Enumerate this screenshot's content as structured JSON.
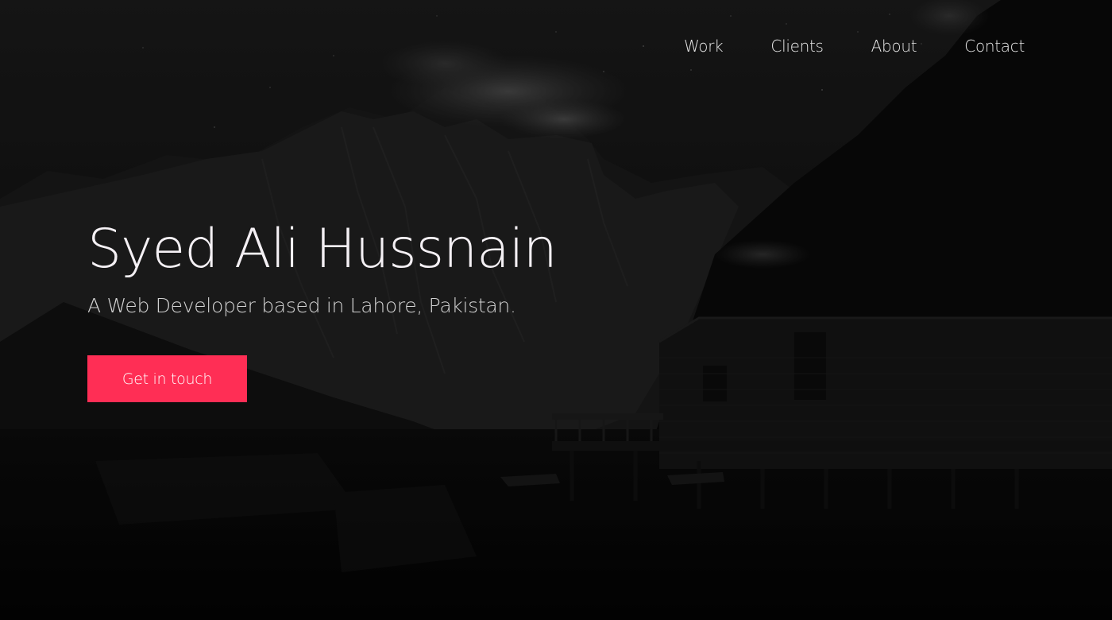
{
  "nav": {
    "items": [
      {
        "label": "Work"
      },
      {
        "label": "Clients"
      },
      {
        "label": "About"
      },
      {
        "label": "Contact"
      }
    ]
  },
  "hero": {
    "title": "Syed Ali Hussnain",
    "subtitle": "A Web Developer based in Lahore, Pakistan.",
    "cta_label": "Get in touch",
    "background": "dark-mountain-lake-cabin-photo"
  },
  "colors": {
    "accent": "#ff2e55",
    "background": "#060606",
    "text": "#f4f0f4"
  }
}
